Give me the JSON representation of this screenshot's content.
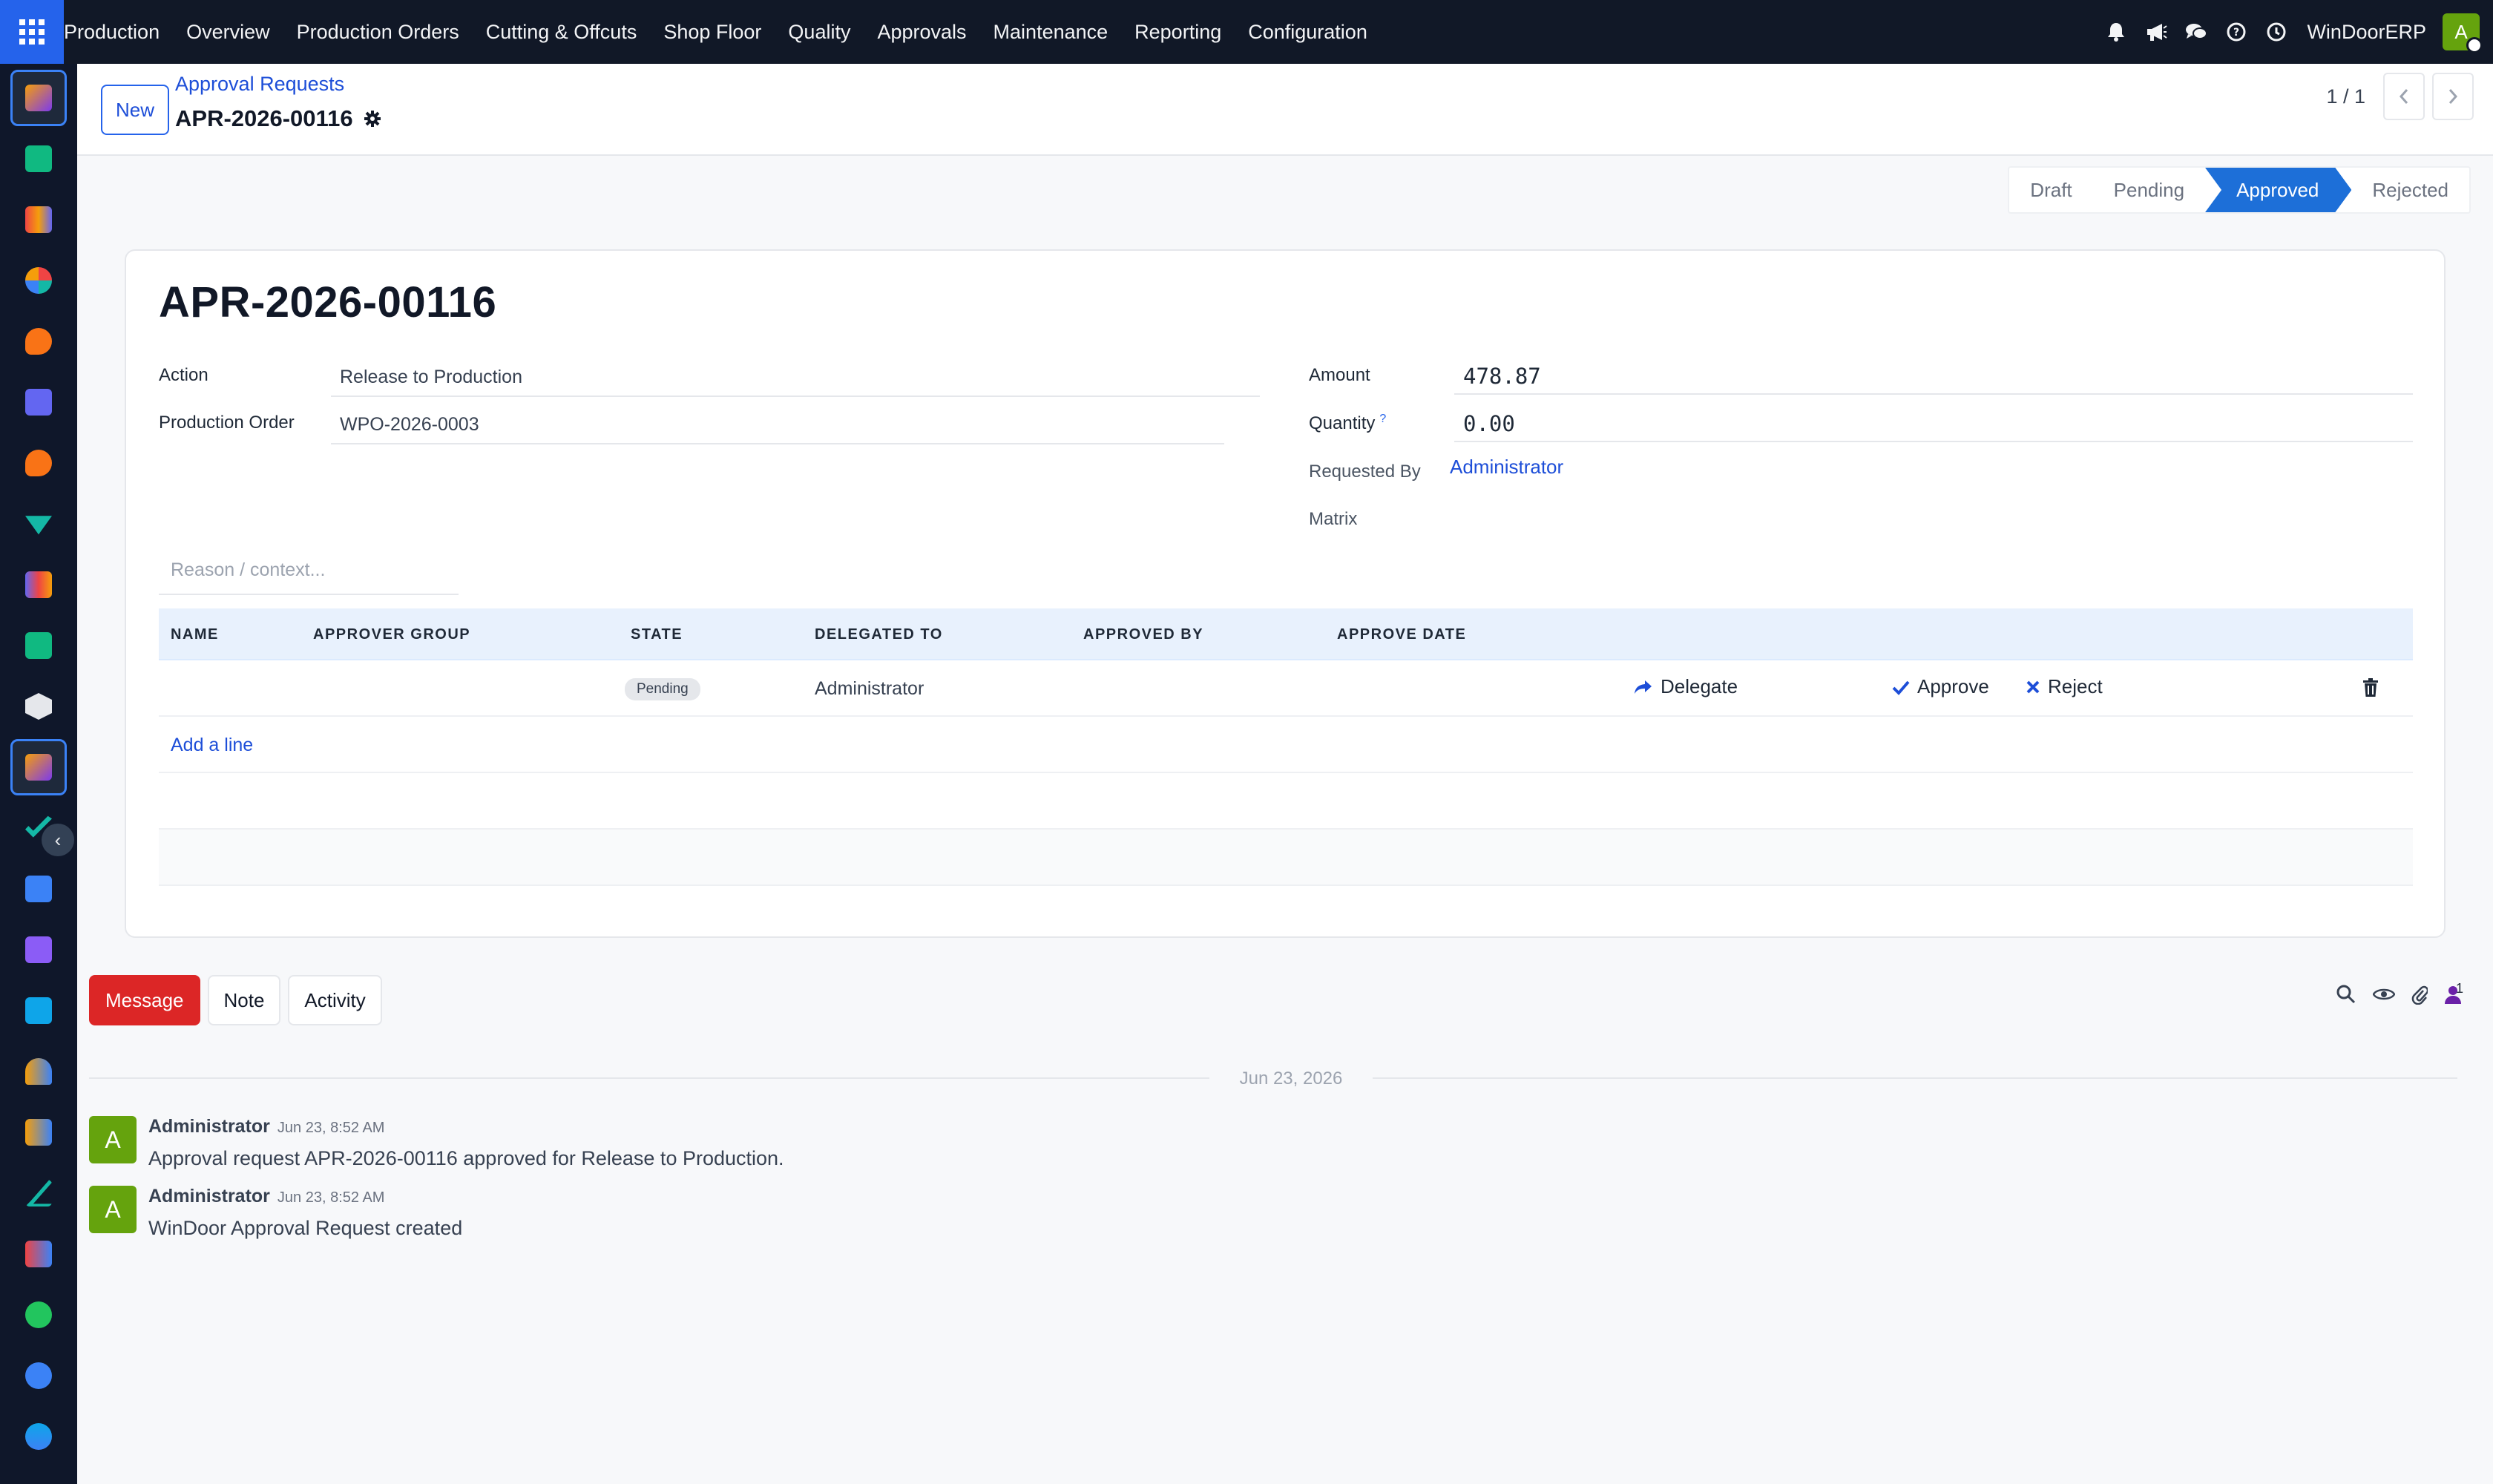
{
  "navbar": {
    "app_name": "Production",
    "menu": [
      "Overview",
      "Production Orders",
      "Cutting & Offcuts",
      "Shop Floor",
      "Quality",
      "Approvals",
      "Maintenance",
      "Reporting",
      "Configuration"
    ],
    "company": "WinDoorERP",
    "user_initial": "A",
    "icons": [
      "bell-icon",
      "megaphone-icon",
      "chat-icon",
      "help-icon",
      "clock-icon"
    ]
  },
  "control": {
    "new_label": "New",
    "breadcrumb": "Approval Requests",
    "record_name": "APR-2026-00116",
    "pager": "1 / 1"
  },
  "statusbar": {
    "stages": [
      "Draft",
      "Pending",
      "Approved",
      "Rejected"
    ],
    "current": "Approved"
  },
  "form": {
    "title": "APR-2026-00116",
    "action_label": "Action",
    "action_value": "Release to Production",
    "order_label": "Production Order",
    "order_value": "WPO-2026-0003",
    "amount_label": "Amount",
    "amount_value": "478.87",
    "quantity_label": "Quantity",
    "quantity_help": "?",
    "quantity_value": "0.00",
    "requested_by_label": "Requested By",
    "requested_by_value": "Administrator",
    "matrix_label": "Matrix",
    "reason_placeholder": "Reason / context..."
  },
  "table": {
    "headers": [
      "NAME",
      "APPROVER GROUP",
      "STATE",
      "DELEGATED TO",
      "APPROVED BY",
      "APPROVE DATE"
    ],
    "rows": [
      {
        "name": "",
        "approver_group": "",
        "state": "Pending",
        "delegated_to": "Administrator",
        "approved_by": "",
        "approve_date": "",
        "actions": [
          "Delegate",
          "Approve",
          "Reject"
        ]
      }
    ],
    "add_line": "Add a line"
  },
  "chatter": {
    "buttons": [
      "Message",
      "Note",
      "Activity"
    ],
    "followers_count": "1",
    "date_separator": "Jun 23, 2026",
    "messages": [
      {
        "initial": "A",
        "author": "Administrator",
        "time": "Jun 23, 8:52 AM",
        "body": "Approval request APR-2026-00116 approved for Release to Production."
      },
      {
        "initial": "A",
        "author": "Administrator",
        "time": "Jun 23, 8:52 AM",
        "body": "WinDoor Approval Request created"
      }
    ]
  },
  "colors": {
    "navbar_bg": "#111827",
    "accent": "#2563eb",
    "current_stage": "#1d6fd8",
    "message_button": "#dc2626",
    "avatar": "#65a30d"
  }
}
